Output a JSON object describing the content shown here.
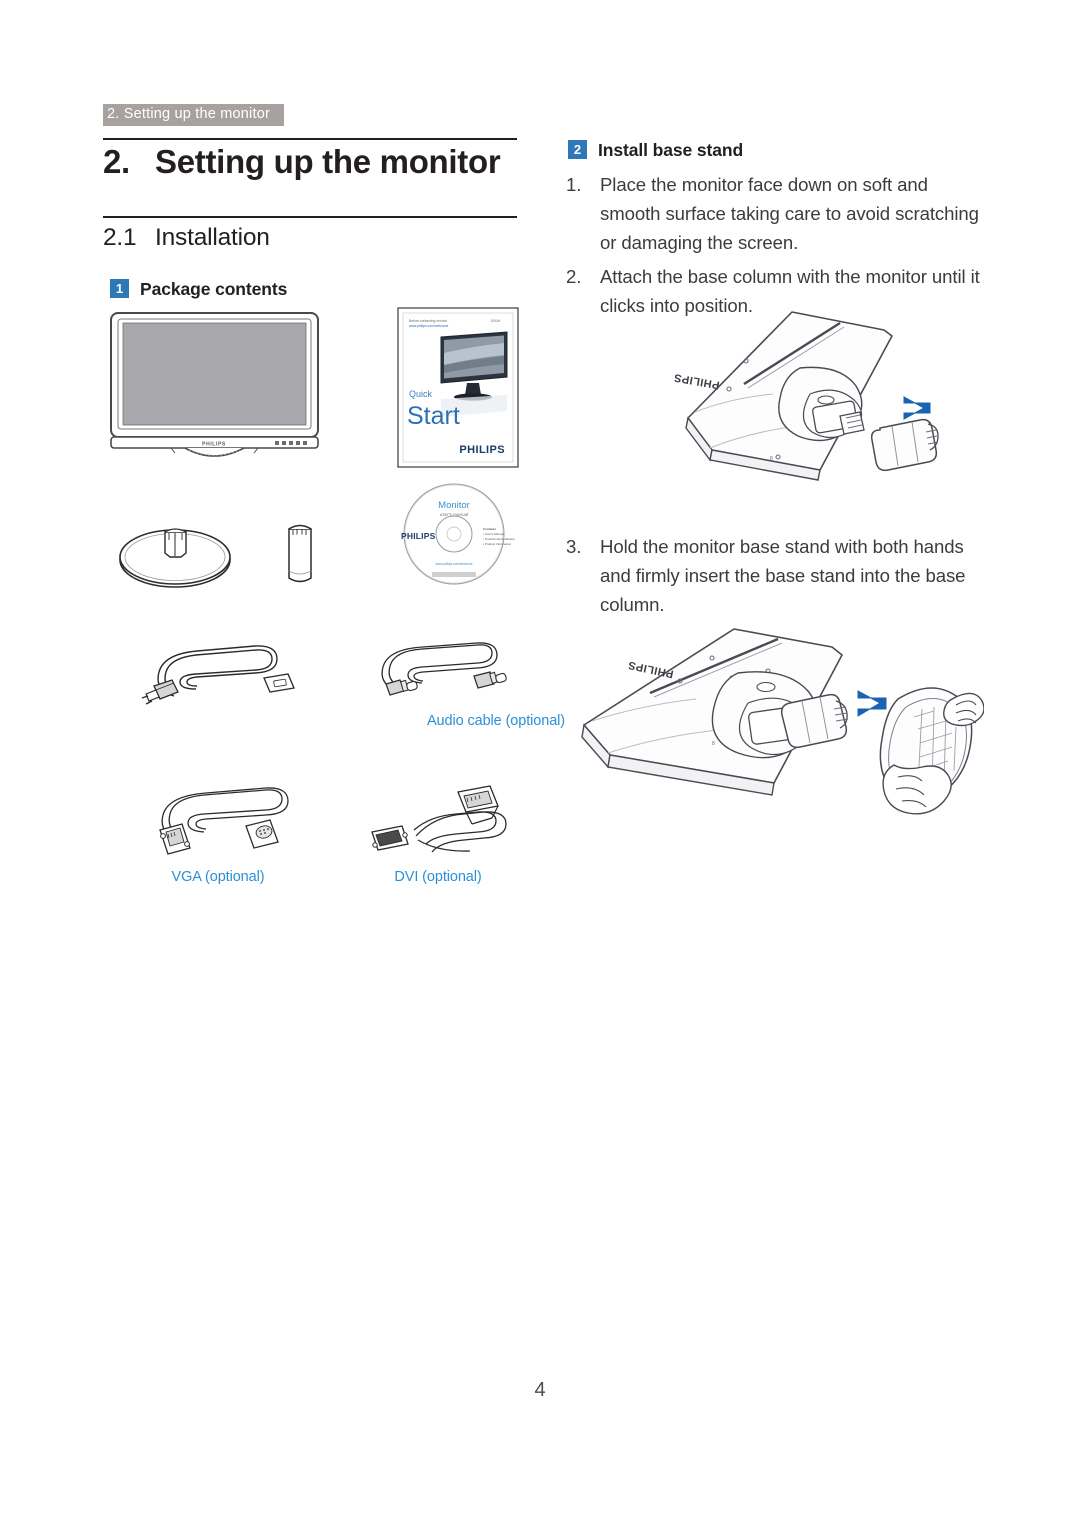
{
  "document": {
    "running_header": "2. Setting up the monitor",
    "chapter_number": "2.",
    "chapter_title": "Setting up the monitor",
    "section_number": "2.1",
    "section_title": "Installation",
    "page_number": "4"
  },
  "left_column": {
    "subsection": {
      "badge": "1",
      "label": "Package contents"
    },
    "items": [
      {
        "name": "monitor",
        "caption": ""
      },
      {
        "name": "quick-start-guide",
        "caption": ""
      },
      {
        "name": "base-stand",
        "caption": ""
      },
      {
        "name": "base-column",
        "caption": ""
      },
      {
        "name": "cd-rom",
        "caption": ""
      },
      {
        "name": "power-cable",
        "caption": ""
      },
      {
        "name": "audio-cable",
        "caption": "Audio cable (optional)"
      },
      {
        "name": "vga-cable",
        "caption": "VGA (optional)"
      },
      {
        "name": "dvi-cable",
        "caption": "DVI (optional)"
      }
    ],
    "captions": {
      "audio": "Audio cable (optional)",
      "vga": "VGA (optional)",
      "dvi": "DVI (optional)"
    },
    "monitor_art": {
      "brand": "PHILIPS",
      "button_count": 5
    },
    "quick_start_art": {
      "top_line_1": "Before contacting service",
      "top_line_2": "www.philips.com/welcome",
      "top_right": "190LM",
      "word_1": "Quick",
      "word_2": "Start",
      "brand": "PHILIPS"
    },
    "cd_art": {
      "title": "Monitor",
      "subtitle": "user's manual",
      "brand": "PHILIPS",
      "contents_heading": "Contents",
      "contents": [
        "User's Manual",
        "SmartControl software",
        "Product Information"
      ],
      "url": "www.philips.com/welcome"
    }
  },
  "right_column": {
    "subsection": {
      "badge": "2",
      "label": "Install base stand"
    },
    "steps_group_1": [
      {
        "number": "1.",
        "text": "Place the monitor face down on soft and smooth surface taking care to avoid scratching or damaging the screen."
      },
      {
        "number": "2.",
        "text": "Attach the base column with the monitor until it clicks into position."
      }
    ],
    "steps_group_2": [
      {
        "number": "3.",
        "text": "Hold the monitor base stand with both hands and firmly insert the base stand into the base column."
      }
    ],
    "diagram_1": {
      "name": "attach-base-column-diagram",
      "brand": "PHILIPS",
      "arrow_direction": "left"
    },
    "diagram_2": {
      "name": "insert-base-stand-diagram",
      "brand": "PHILIPS",
      "arrow_direction": "left"
    }
  },
  "colors": {
    "accent_blue": "#2e78b8",
    "caption_blue": "#2b8fd8",
    "header_gray": "#a7a2a0",
    "text": "#231f20",
    "body_text": "#3c3c3c",
    "screen_gray": "#a8a8ac",
    "arrow_blue": "#1a63b4"
  }
}
